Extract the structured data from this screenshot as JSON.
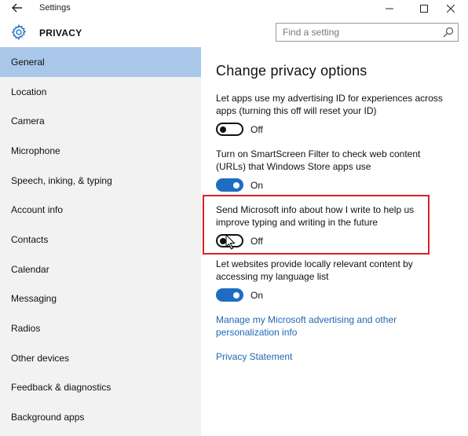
{
  "window": {
    "title": "Settings"
  },
  "header": {
    "app_title": "PRIVACY",
    "search_placeholder": "Find a setting"
  },
  "sidebar": {
    "items": [
      {
        "label": "General",
        "selected": true
      },
      {
        "label": "Location"
      },
      {
        "label": "Camera"
      },
      {
        "label": "Microphone"
      },
      {
        "label": "Speech, inking, & typing"
      },
      {
        "label": "Account info"
      },
      {
        "label": "Contacts"
      },
      {
        "label": "Calendar"
      },
      {
        "label": "Messaging"
      },
      {
        "label": "Radios"
      },
      {
        "label": "Other devices"
      },
      {
        "label": "Feedback & diagnostics"
      },
      {
        "label": "Background apps"
      }
    ]
  },
  "main": {
    "title": "Change privacy options",
    "options": [
      {
        "description": "Let apps use my advertising ID for experiences across apps (turning this off will reset your ID)",
        "state": "Off"
      },
      {
        "description": "Turn on SmartScreen Filter to check web content (URLs) that Windows Store apps use",
        "state": "On"
      },
      {
        "description": "Send Microsoft info about how I write to help us improve typing and writing in the future",
        "state": "Off"
      },
      {
        "description": "Let websites provide locally relevant content by accessing my language list",
        "state": "On"
      }
    ],
    "links": [
      {
        "label": "Manage my Microsoft advertising and other personalization info"
      },
      {
        "label": "Privacy Statement"
      }
    ]
  },
  "colors": {
    "accent": "#1f6dc3",
    "selection": "#a9c7e8",
    "highlight": "#d8212a",
    "link": "#2068b5"
  }
}
